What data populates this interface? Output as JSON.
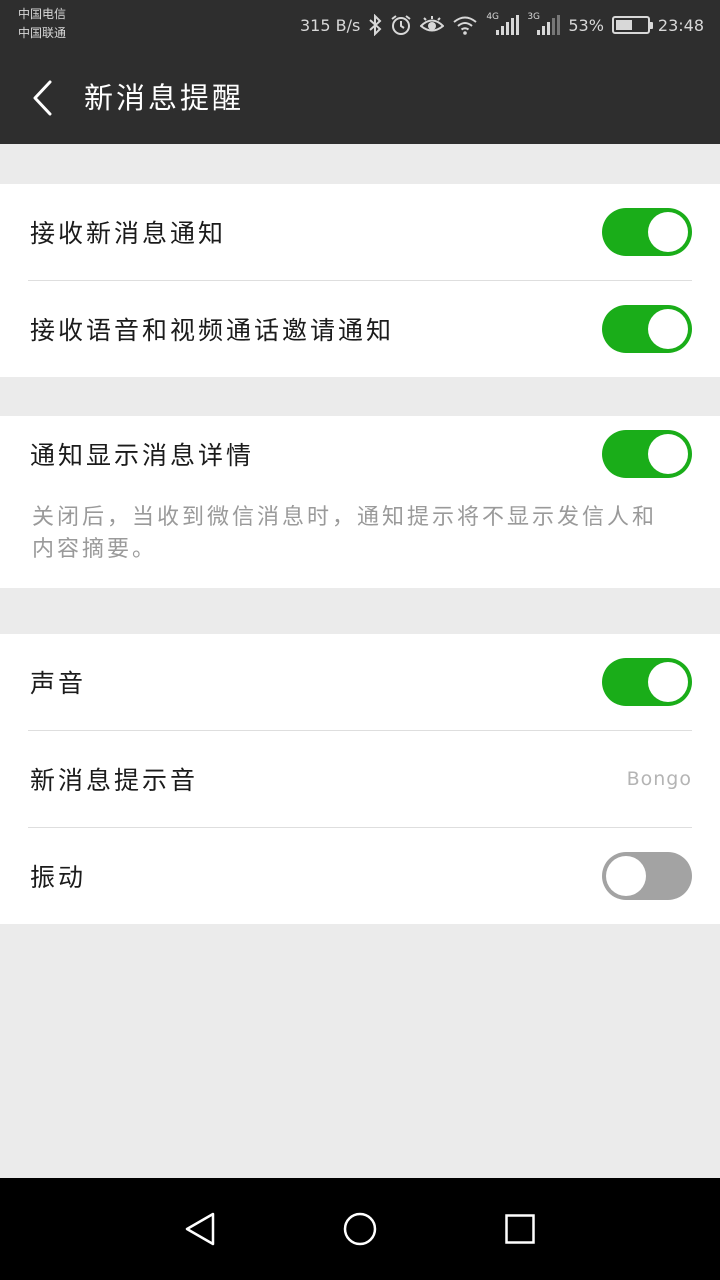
{
  "status_bar": {
    "carrier_1": "中国电信",
    "carrier_2": "中国联通",
    "net_speed": "315 B/s",
    "signal_1_type": "4G",
    "signal_2_type": "3G",
    "battery": "53%",
    "battery_level": 0.53,
    "time": "23:48",
    "icons": [
      "bluetooth-icon",
      "alarm-icon",
      "eye-icon",
      "wifi-icon",
      "signal-icon",
      "battery-icon"
    ]
  },
  "header": {
    "back_icon": "chevron-left-icon",
    "title": "新消息提醒"
  },
  "groups": {
    "notifications": {
      "receive_new_message": {
        "label": "接收新消息通知",
        "on": true
      },
      "receive_call_invite": {
        "label": "接收语音和视频通话邀请通知",
        "on": true
      }
    },
    "details": {
      "show_details": {
        "label": "通知显示消息详情",
        "on": true
      },
      "description": "关闭后，当收到微信消息时，通知提示将不显示发信人和内容摘要。"
    },
    "sound": {
      "sound": {
        "label": "声音",
        "on": true
      },
      "ringtone": {
        "label": "新消息提示音",
        "value": "Bongo"
      },
      "vibrate": {
        "label": "振动",
        "on": false
      }
    }
  },
  "nav_bar": {
    "icons": [
      "back-triangle-icon",
      "home-circle-icon",
      "recents-square-icon"
    ]
  },
  "colors": {
    "header_bg": "#2e2e2e",
    "page_bg": "#ebebeb",
    "toggle_on": "#1aad19",
    "toggle_off": "#a3a3a3",
    "nav_bg": "#000000"
  }
}
